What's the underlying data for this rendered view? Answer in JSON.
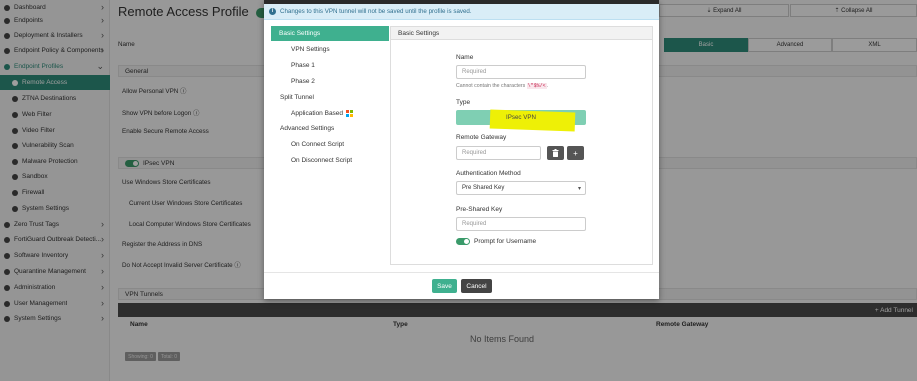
{
  "sidebar": {
    "items": [
      {
        "label": "Dashboard",
        "chev": "›",
        "active": false,
        "sub": false
      },
      {
        "label": "Endpoints",
        "chev": "›",
        "active": false,
        "sub": false
      },
      {
        "label": "Deployment & Installers",
        "chev": "›",
        "active": false,
        "sub": false
      },
      {
        "label": "Endpoint Policy & Components",
        "chev": "›",
        "active": false,
        "sub": false
      },
      {
        "label": "Endpoint Profiles",
        "chev": "⌄",
        "active": false,
        "sub": false,
        "accent": true
      },
      {
        "label": "Remote Access",
        "chev": "",
        "active": true,
        "sub": true
      },
      {
        "label": "ZTNA Destinations",
        "chev": "",
        "active": false,
        "sub": true
      },
      {
        "label": "Web Filter",
        "chev": "",
        "active": false,
        "sub": true
      },
      {
        "label": "Video Filter",
        "chev": "",
        "active": false,
        "sub": true
      },
      {
        "label": "Vulnerability Scan",
        "chev": "",
        "active": false,
        "sub": true
      },
      {
        "label": "Malware Protection",
        "chev": "",
        "active": false,
        "sub": true
      },
      {
        "label": "Sandbox",
        "chev": "",
        "active": false,
        "sub": true
      },
      {
        "label": "Firewall",
        "chev": "",
        "active": false,
        "sub": true
      },
      {
        "label": "System Settings",
        "chev": "",
        "active": false,
        "sub": true
      },
      {
        "label": "Zero Trust Tags",
        "chev": "›",
        "active": false,
        "sub": false
      },
      {
        "label": "FortiGuard Outbreak Detecti...",
        "chev": "›",
        "active": false,
        "sub": false
      },
      {
        "label": "Software Inventory",
        "chev": "›",
        "active": false,
        "sub": false
      },
      {
        "label": "Quarantine Management",
        "chev": "›",
        "active": false,
        "sub": false
      },
      {
        "label": "Administration",
        "chev": "›",
        "active": false,
        "sub": false
      },
      {
        "label": "User Management",
        "chev": "›",
        "active": false,
        "sub": false
      },
      {
        "label": "System Settings",
        "chev": "›",
        "active": false,
        "sub": false
      }
    ]
  },
  "header": {
    "title": "Remote Access Profile",
    "expand_all": "⇣ Expand All",
    "collapse_all": "⇡ Collapse All"
  },
  "view_tabs": {
    "basic": "Basic",
    "advanced": "Advanced",
    "xml": "XML"
  },
  "main": {
    "name_label": "Name",
    "general_header": "General",
    "allow_personal_vpn": "Allow Personal VPN",
    "show_vpn_before_logon": "Show VPN before Logon",
    "enable_secure_remote_access": "Enable Secure Remote Access",
    "ipsec_vpn_header": "IPsec VPN",
    "use_windows_store_certs": "Use Windows Store Certificates",
    "current_user_store": "Current User Windows Store Certificates",
    "local_computer_store": "Local Computer Windows Store Certificates",
    "register_dns": "Register the Address in DNS",
    "no_invalid_cert": "Do Not Accept Invalid Server Certificate",
    "vpn_tunnels_header": "VPN Tunnels",
    "add_tunnel": "+ Add Tunnel",
    "table_columns": [
      "Name",
      "Type",
      "Remote Gateway"
    ],
    "no_items": "No Items Found",
    "showing": "Showing: 0",
    "total": "Total: 0"
  },
  "modal": {
    "info_message": "Changes to this VPN tunnel will not be saved until the profile is saved.",
    "nav": [
      {
        "label": "Basic Settings",
        "kind": "sel"
      },
      {
        "label": "VPN Settings",
        "kind": "child"
      },
      {
        "label": "Phase 1",
        "kind": "child"
      },
      {
        "label": "Phase 2",
        "kind": "child"
      },
      {
        "label": "Split Tunnel",
        "kind": "group"
      },
      {
        "label": "Application Based",
        "kind": "child"
      },
      {
        "label": "Advanced Settings",
        "kind": "group"
      },
      {
        "label": "On Connect Script",
        "kind": "child"
      },
      {
        "label": "On Disconnect Script",
        "kind": "child"
      }
    ],
    "panel_title": "Basic Settings",
    "name_label": "Name",
    "name_placeholder": "Required",
    "name_hint_prefix": "Cannot contain the characters",
    "name_hint_chars": "\\\"$%/<",
    "type_label": "Type",
    "type_value": "IPsec VPN",
    "remote_gateway_label": "Remote Gateway",
    "remote_gateway_placeholder": "Required",
    "auth_method_label": "Authentication Method",
    "auth_method_value": "Pre Shared Key",
    "psk_label": "Pre-Shared Key",
    "psk_placeholder": "Required",
    "prompt_username_label": "Prompt for Username",
    "save_label": "Save",
    "cancel_label": "Cancel"
  },
  "colors": {
    "accent": "#2e8b7a",
    "active_nav": "#3fb08f",
    "type_fill": "#7fcfb3",
    "highlight": "#eef006",
    "info_bg": "#d9edf7"
  }
}
